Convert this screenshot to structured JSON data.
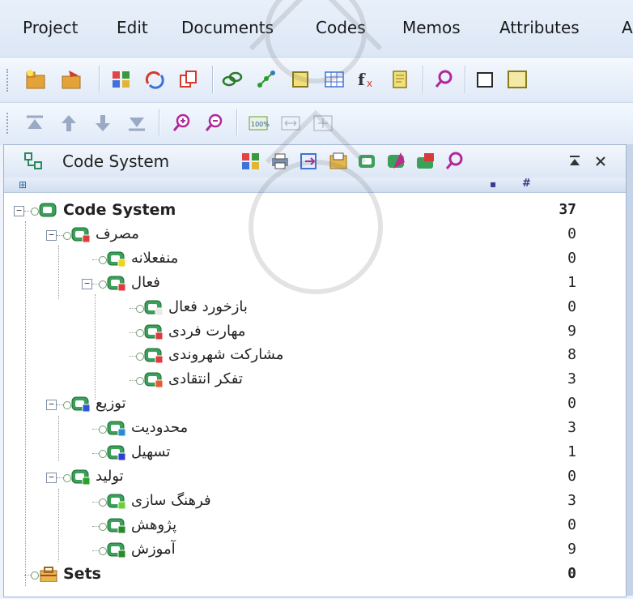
{
  "menu": [
    "Project",
    "Edit",
    "Documents",
    "Codes",
    "Memos",
    "Attributes",
    "A"
  ],
  "panel": {
    "title": "Code System",
    "col_headers": [
      "#"
    ]
  },
  "tree": {
    "root": {
      "label": "Code System",
      "count": "37"
    },
    "nodes": [
      {
        "label": "مصرف",
        "count": "0",
        "color": "#e03b3b",
        "level": 1
      },
      {
        "label": "منفعلانه",
        "count": "0",
        "color": "#f2d21b",
        "level": 2
      },
      {
        "label": "فعال",
        "count": "1",
        "color": "#e03b3b",
        "level": 2
      },
      {
        "label": "بازخورد فعال",
        "count": "0",
        "color": "",
        "level": 3
      },
      {
        "label": "مهارت فردی",
        "count": "9",
        "color": "#e03b3b",
        "level": 3
      },
      {
        "label": "مشارکت شهروندی",
        "count": "8",
        "color": "#e03b3b",
        "level": 3
      },
      {
        "label": "تفکر انتقادی",
        "count": "3",
        "color": "#e65a2f",
        "level": 3
      },
      {
        "label": "توزیع",
        "count": "0",
        "color": "#2b58d8",
        "level": 1
      },
      {
        "label": "محدودیت",
        "count": "3",
        "color": "#2b8ad8",
        "level": 2
      },
      {
        "label": "تسهیل",
        "count": "1",
        "color": "#2b3fd8",
        "level": 2
      },
      {
        "label": "تولید",
        "count": "0",
        "color": "#2aa02a",
        "level": 1
      },
      {
        "label": "فرهنگ سازی",
        "count": "3",
        "color": "#6ecf3a",
        "level": 2
      },
      {
        "label": "پژوهش",
        "count": "0",
        "color": "#2a8a2a",
        "level": 2
      },
      {
        "label": "آموزش",
        "count": "9",
        "color": "#2a8a2a",
        "level": 2
      }
    ],
    "sets": {
      "label": "Sets",
      "count": "0"
    }
  }
}
